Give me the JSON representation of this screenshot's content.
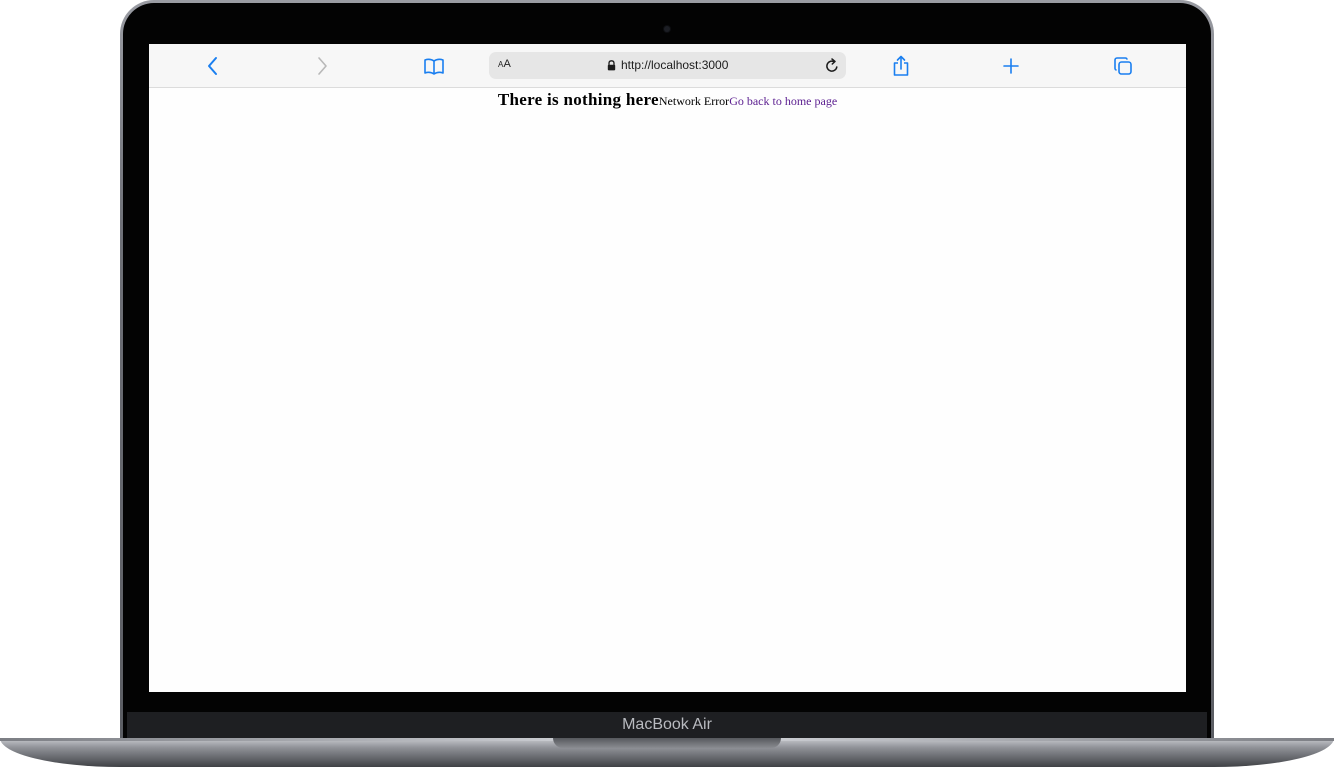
{
  "device": {
    "label": "MacBook Air"
  },
  "browser": {
    "address_bar": {
      "reader_label_small": "A",
      "reader_label_large": "A",
      "url": "http://localhost:3000"
    },
    "icons": {
      "back": "chevron-left-icon",
      "forward": "chevron-right-icon",
      "bookmarks": "book-icon",
      "lock": "lock-icon",
      "reload": "reload-icon",
      "share": "share-icon",
      "new_tab": "plus-icon",
      "tabs": "tabs-icon"
    },
    "colors": {
      "accent": "#1a7ff0",
      "disabled": "#b8b8b8"
    }
  },
  "page": {
    "heading": "There is nothing here",
    "error_text": "Network Error",
    "home_link": "Go back to home page",
    "link_color": "#5a1d8f"
  }
}
